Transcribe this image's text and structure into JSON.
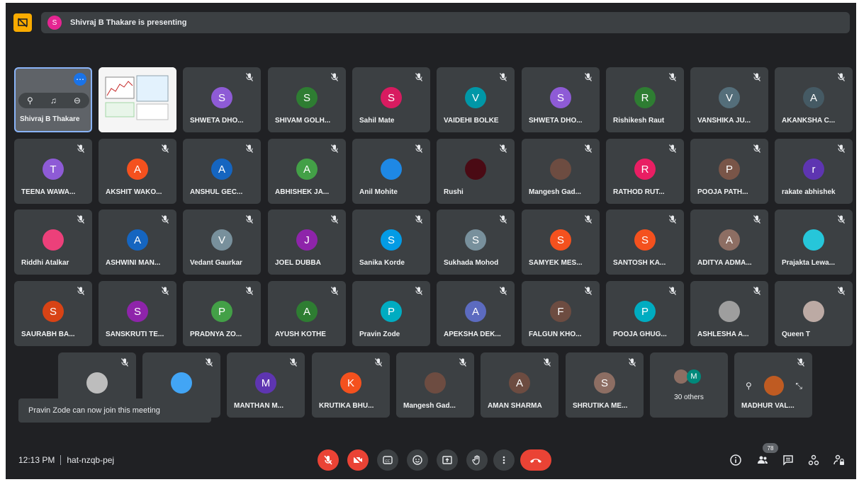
{
  "banner": {
    "presenter_initial": "S",
    "text": "Shivraj B Thakare is presenting"
  },
  "self_tile": {
    "name": "Shivraj B Thakare"
  },
  "participants": [
    {
      "name": "SHWETA DHO...",
      "initial": "S",
      "color": "#8e5bd6"
    },
    {
      "name": "SHIVAM GOLH...",
      "initial": "S",
      "color": "#2e7d32"
    },
    {
      "name": "Sahil Mate",
      "initial": "S",
      "color": "#d81b60"
    },
    {
      "name": "VAIDEHI BOLKE",
      "initial": "V",
      "color": "#0097a7"
    },
    {
      "name": "SHWETA DHO...",
      "initial": "S",
      "color": "#8e5bd6"
    },
    {
      "name": "Rishikesh Raut",
      "initial": "R",
      "color": "#2e7d32"
    },
    {
      "name": "VANSHIKA JU...",
      "initial": "V",
      "color": "#546e7a"
    },
    {
      "name": "AKANKSHA C...",
      "initial": "A",
      "color": "#455a64"
    },
    {
      "name": "TEENA WAWA...",
      "initial": "T",
      "color": "#8e5bd6"
    },
    {
      "name": "AKSHIT WAKO...",
      "initial": "A",
      "color": "#f4511e"
    },
    {
      "name": "ANSHUL GEC...",
      "initial": "A",
      "color": "#1565c0"
    },
    {
      "name": "ABHISHEK JA...",
      "initial": "A",
      "color": "#43a047"
    },
    {
      "name": "Anil Mohite",
      "initial": "",
      "color": "#1e88e5"
    },
    {
      "name": "Rushi",
      "initial": "",
      "color": "#4a0a14"
    },
    {
      "name": "Mangesh Gad...",
      "initial": "",
      "color": "#6d4c41"
    },
    {
      "name": "RATHOD RUT...",
      "initial": "R",
      "color": "#e91e63"
    },
    {
      "name": "POOJA PATH...",
      "initial": "P",
      "color": "#795548"
    },
    {
      "name": "rakate abhishek",
      "initial": "r",
      "color": "#5e35b1"
    },
    {
      "name": "Riddhi Atalkar",
      "initial": "",
      "color": "#ec407a"
    },
    {
      "name": "ASHWINI MAN...",
      "initial": "A",
      "color": "#1565c0"
    },
    {
      "name": "Vedant Gaurkar",
      "initial": "V",
      "color": "#78909c"
    },
    {
      "name": "JOEL DUBBA",
      "initial": "J",
      "color": "#8e24aa"
    },
    {
      "name": "Sanika Korde",
      "initial": "S",
      "color": "#039be5"
    },
    {
      "name": "Sukhada Mohod",
      "initial": "S",
      "color": "#78909c"
    },
    {
      "name": "SAMYEK MES...",
      "initial": "S",
      "color": "#f4511e"
    },
    {
      "name": "SANTOSH KA...",
      "initial": "S",
      "color": "#f4511e"
    },
    {
      "name": "ADITYA ADMA...",
      "initial": "A",
      "color": "#8d6e63"
    },
    {
      "name": "Prajakta Lewa...",
      "initial": "",
      "color": "#26c6da"
    },
    {
      "name": "SAURABH BA...",
      "initial": "S",
      "color": "#d84315"
    },
    {
      "name": "SANSKRUTI TE...",
      "initial": "S",
      "color": "#8e24aa"
    },
    {
      "name": "PRADNYA ZO...",
      "initial": "P",
      "color": "#43a047"
    },
    {
      "name": "AYUSH KOTHE",
      "initial": "A",
      "color": "#2e7d32"
    },
    {
      "name": "Pravin Zode",
      "initial": "P",
      "color": "#00acc1"
    },
    {
      "name": "APEKSHA DEK...",
      "initial": "A",
      "color": "#5c6bc0"
    },
    {
      "name": "FALGUN KHO...",
      "initial": "F",
      "color": "#6d4c41"
    },
    {
      "name": "POOJA GHUG...",
      "initial": "P",
      "color": "#00acc1"
    },
    {
      "name": "ASHLESHA A...",
      "initial": "",
      "color": "#9e9e9e"
    },
    {
      "name": "Queen T",
      "initial": "",
      "color": "#bcaaa4"
    }
  ],
  "last_row": [
    {
      "name": "",
      "initial": "",
      "color": "#bdbdbd"
    },
    {
      "name": "",
      "initial": "",
      "color": "#42a5f5"
    },
    {
      "name": "MANTHAN M...",
      "initial": "M",
      "color": "#5e35b1"
    },
    {
      "name": "KRUTIKA BHU...",
      "initial": "K",
      "color": "#f4511e"
    },
    {
      "name": "Mangesh Gad...",
      "initial": "",
      "color": "#6d4c41"
    },
    {
      "name": "AMAN SHARMA",
      "initial": "A",
      "color": "#6d4c41"
    },
    {
      "name": "SHRUTIKA ME...",
      "initial": "S",
      "color": "#8d6e63"
    }
  ],
  "others_tile": {
    "label": "30 others",
    "initial": "M"
  },
  "madhur_tile": {
    "name": "MADHUR VAL..."
  },
  "toast": {
    "text": "Pravin Zode can now join this meeting"
  },
  "bottom": {
    "time": "12:13 PM",
    "meeting_code": "hat-nzqb-pej",
    "people_count": "78"
  }
}
